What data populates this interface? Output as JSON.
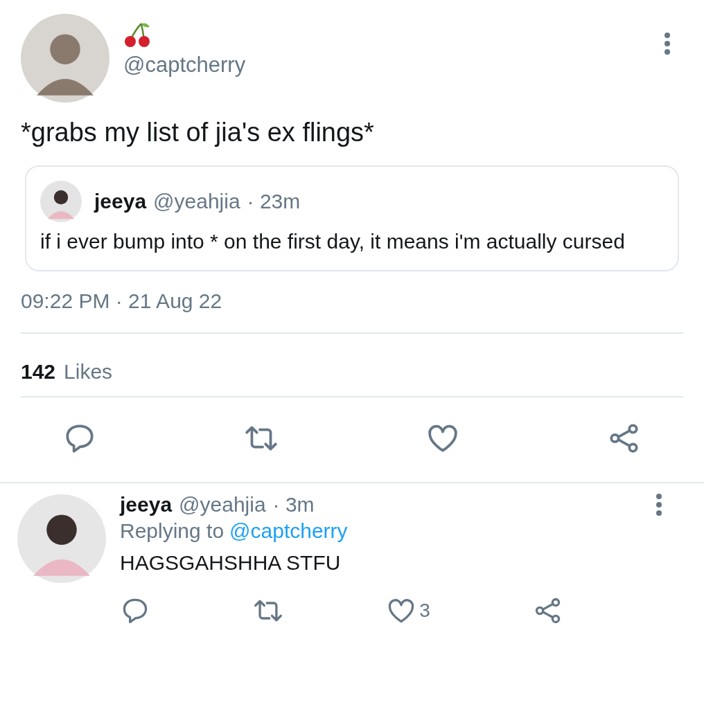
{
  "tweet": {
    "handle": "@captcherry",
    "text": "*grabs my list of jia's ex flings*",
    "quote": {
      "name": "jeeya",
      "handle": "@yeahjia",
      "time": "· 23m",
      "text": "if i ever bump into * on the first day, it means i'm actually cursed"
    },
    "timestamp": "09:22 PM · 21 Aug 22",
    "likes_count": "142",
    "likes_label": "Likes"
  },
  "reply": {
    "name": "jeeya",
    "handle": "@yeahjia",
    "time": "· 3m",
    "replying_prefix": "Replying to",
    "replying_handle": "@captcherry",
    "text": "HAGSGAHSHHA STFU",
    "like_count": "3"
  }
}
